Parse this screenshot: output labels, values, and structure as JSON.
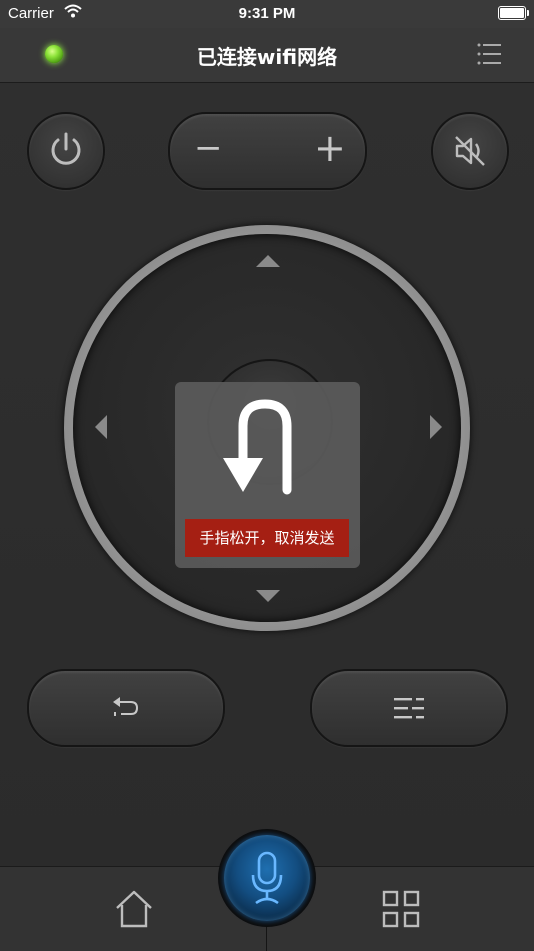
{
  "status_bar": {
    "carrier": "Carrier",
    "time": "9:31 PM"
  },
  "header": {
    "title": "已连接wifi网络",
    "connection_led_color": "#7ed321"
  },
  "controls": {
    "volume_minus": "−",
    "volume_plus": "+"
  },
  "overlay": {
    "message": "手指松开，取消发送"
  },
  "icons": {
    "power": "power-icon",
    "mute": "mute-icon",
    "back": "back-icon",
    "menu": "menu-icon",
    "home": "home-icon",
    "apps": "apps-grid-icon",
    "mic": "microphone-icon"
  },
  "colors": {
    "accent_blue": "#1a73c7",
    "cancel_red": "#a51f13"
  }
}
